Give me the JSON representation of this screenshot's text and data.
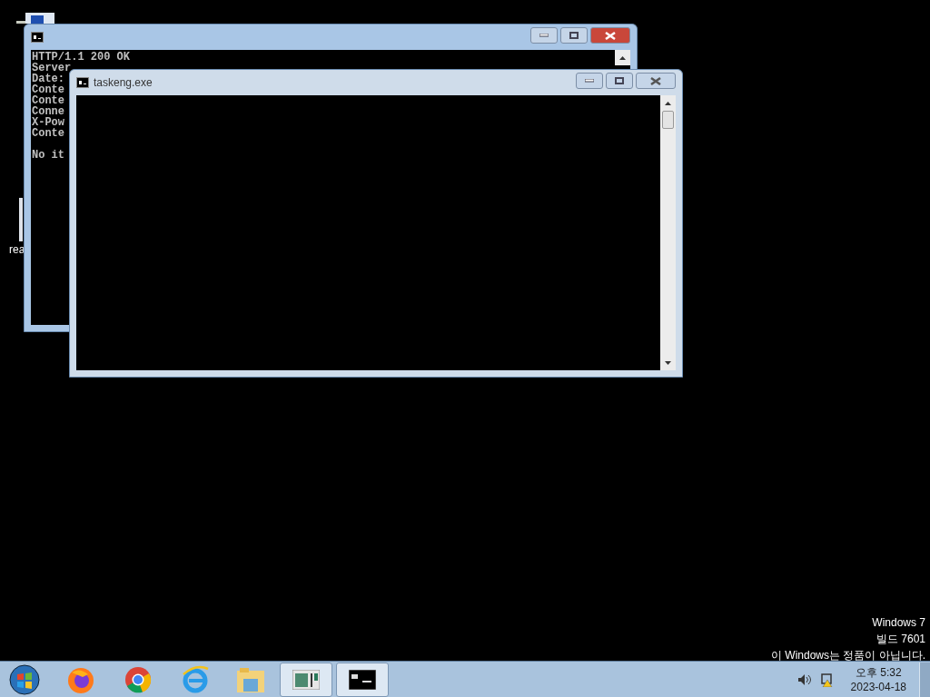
{
  "desktop": {
    "icon_labels": [
      "rea"
    ]
  },
  "windows": [
    {
      "kind": "console",
      "active": true,
      "line_blocks": [
        [
          "HTTP/1.1 200 OK",
          "Server",
          "Date:",
          "Conte",
          "Conte",
          "Conne",
          "X-Pow",
          "Conte"
        ],
        [
          "No it"
        ]
      ]
    },
    {
      "kind": "console",
      "active": false,
      "title": "taskeng.exe"
    }
  ],
  "notice_lines": [
    "Windows 7",
    "빌드 7601",
    "이 Windows는 정품이 아닙니다."
  ],
  "taskbar": {
    "clock_time": "오후 5:32",
    "clock_date": "2023-04-18"
  }
}
